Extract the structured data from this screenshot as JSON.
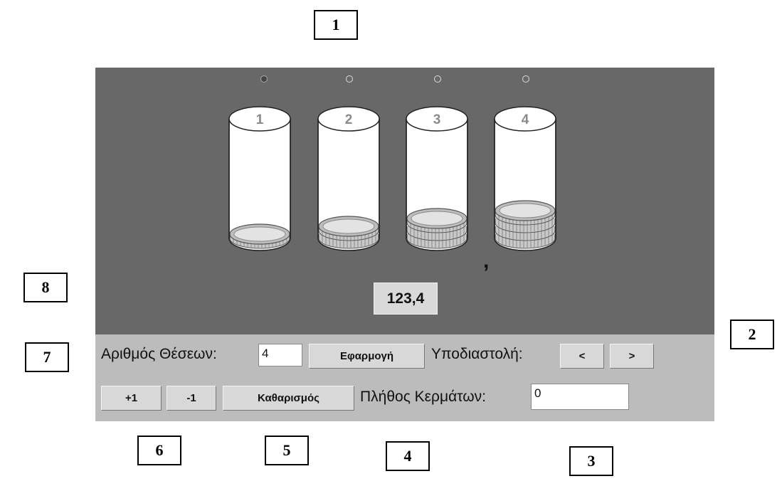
{
  "callouts": [
    "1",
    "2",
    "3",
    "4",
    "5",
    "6",
    "7",
    "8"
  ],
  "tubes": [
    {
      "label": "1",
      "coins": 1
    },
    {
      "label": "2",
      "coins": 2
    },
    {
      "label": "3",
      "coins": 3
    },
    {
      "label": "4",
      "coins": 4
    }
  ],
  "selected_position": 1,
  "display": {
    "value": "123,4"
  },
  "decimal_mark": ",",
  "controls": {
    "positions_label": "Αριθμός Θέσεων:",
    "positions_value": "4",
    "apply_label": "Εφαρμογή",
    "decimal_label": "Υποδιαστολή:",
    "decimal_left": "<",
    "decimal_right": ">",
    "plus_label": "+1",
    "minus_label": "-1",
    "clear_label": "Καθαρισμός",
    "coins_label": "Πλήθος Κερμάτων:",
    "coins_value": "0"
  },
  "colors": {
    "stage": "#686868",
    "panel": "#bcbcbc"
  }
}
